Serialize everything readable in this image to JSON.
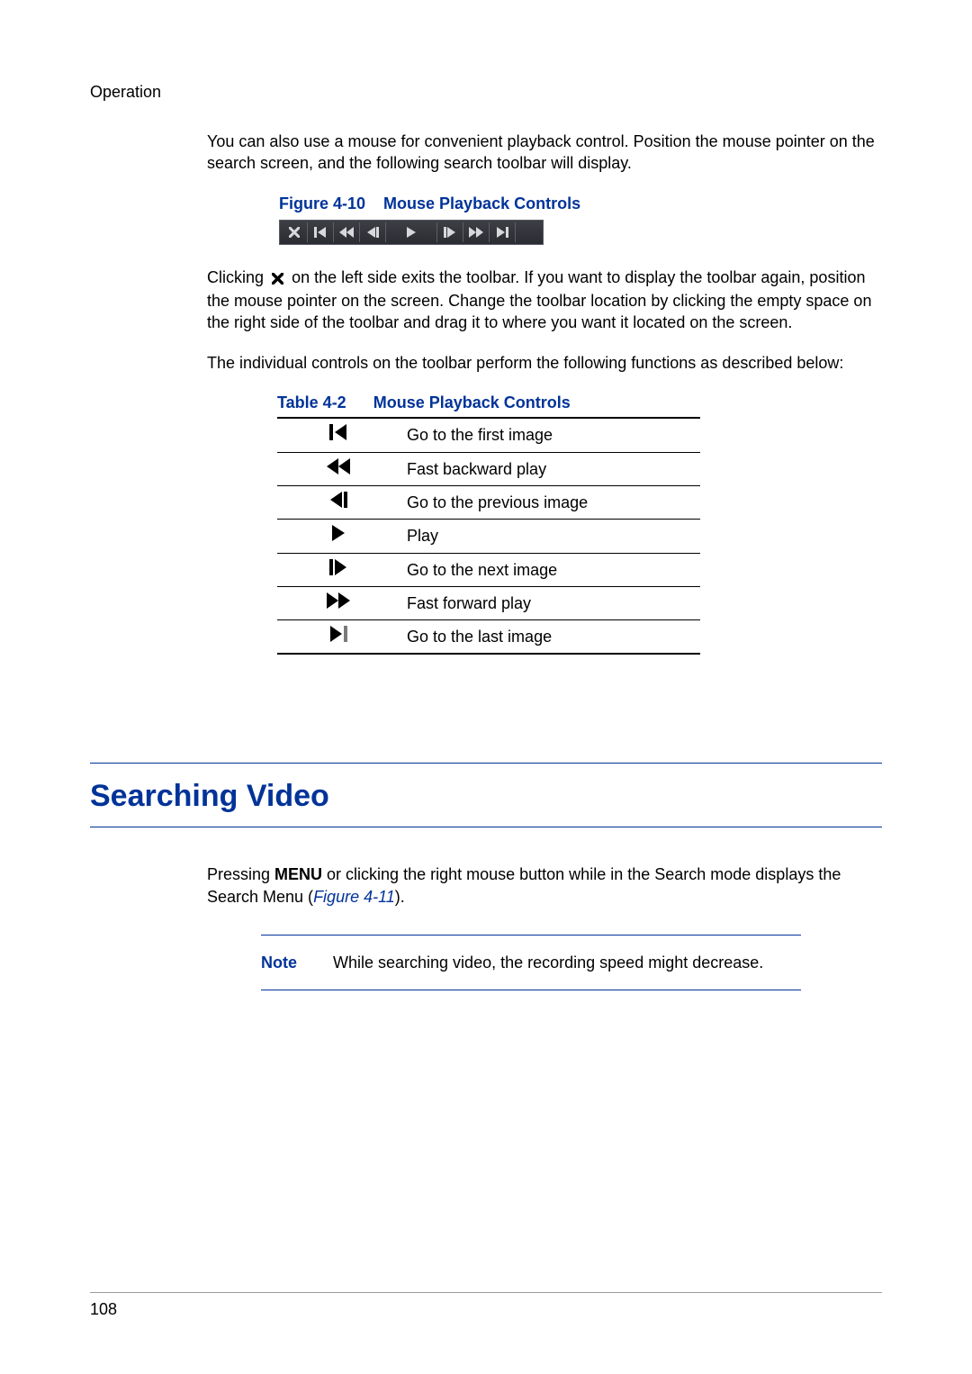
{
  "running_head": "Operation",
  "intro_para": "You can also use a mouse for convenient playback control. Position the mouse pointer on the search screen, and the following search toolbar will display.",
  "figure": {
    "label": "Figure 4-10",
    "title": "Mouse Playback Controls"
  },
  "click_para_before": "Clicking",
  "click_para_after": "on the left side exits the toolbar. If you want to display the toolbar again, position the mouse pointer on the screen. Change the toolbar location by clicking the empty space on the right side of the toolbar and drag it to where you want it located on the screen.",
  "controls_intro": "The individual controls on the toolbar perform the following functions as described below:",
  "table": {
    "label": "Table 4-2",
    "title": "Mouse Playback Controls",
    "rows": [
      {
        "desc": "Go to the first image"
      },
      {
        "desc": "Fast backward play"
      },
      {
        "desc": "Go to the previous image"
      },
      {
        "desc": "Play"
      },
      {
        "desc": "Go to the next image"
      },
      {
        "desc": "Fast forward play"
      },
      {
        "desc": "Go to the last image"
      }
    ]
  },
  "section_heading": "Searching Video",
  "search_para_1": "Pressing ",
  "search_para_bold": "MENU",
  "search_para_2": " or clicking the right mouse button while in the Search mode displays the Search Menu (",
  "search_para_ref": "Figure 4-11",
  "search_para_3": ").",
  "note": {
    "label": "Note",
    "text": "While searching video, the recording speed might decrease."
  },
  "page_number": "108"
}
